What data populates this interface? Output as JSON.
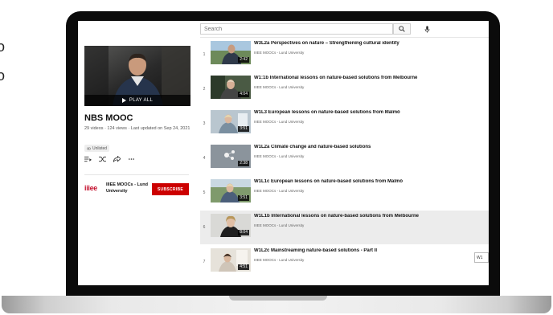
{
  "search": {
    "placeholder": "Search"
  },
  "playlist": {
    "cover_label": "PLAY ALL",
    "title": "NBS MOOC",
    "meta": "29 videos · 124 views · Last updated on Sep 24, 2021",
    "badge": "Unlisted"
  },
  "channel": {
    "logo_text": "iiiee",
    "name": "IIIEE MOOCs - Lund University",
    "subscribe_label": "SUBSCRIBE"
  },
  "videos": [
    {
      "index": "1",
      "title": "W3L2a Perspectives on nature – Strengthening cultural identity",
      "channel": "IIIEE MOOCs - Lund University",
      "duration": "2:42"
    },
    {
      "index": "2",
      "title": "W1:1b International lessons on nature-based solutions from Melbourne",
      "channel": "IIIEE MOOCs - Lund University",
      "duration": "4:04"
    },
    {
      "index": "3",
      "title": "W1L3 European lessons on nature-based solutions from Malmö",
      "channel": "IIIEE MOOCs - Lund University",
      "duration": "3:51"
    },
    {
      "index": "4",
      "title": "W1L2a Climate change and nature-based solutions",
      "channel": "IIIEE MOOCs - Lund University",
      "duration": "2:38"
    },
    {
      "index": "5",
      "title": "W1L1c European lessons on nature-based solutions from Malmö",
      "channel": "IIIEE MOOCs - Lund University",
      "duration": "3:51"
    },
    {
      "index": "6",
      "title": "W1L1b International lessons on nature-based solutions from Melbourne",
      "channel": "IIIEE MOOCs - Lund University",
      "duration": "8:04"
    },
    {
      "index": "7",
      "title": "W1L2c Mainstreaming nature-based solutions - Part II",
      "channel": "IIIEE MOOCs - Lund University",
      "duration": "4:51"
    }
  ],
  "tooltip": {
    "text": "W1"
  },
  "colors": {
    "subscribe": "#cc0000",
    "brand": "#c4122f",
    "selected_row": "#ececec"
  }
}
